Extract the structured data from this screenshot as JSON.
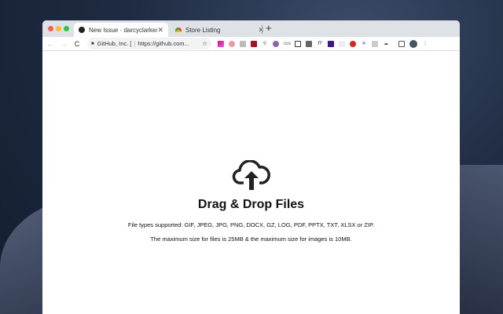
{
  "tabs": [
    {
      "title": "New Issue · darcyclarke/octofi",
      "icon": "github-icon"
    },
    {
      "title": "Store Listing",
      "icon": "chrome-webstore-icon"
    }
  ],
  "omnibox": {
    "site": "GitHub, Inc. [",
    "url": "https://github.com..."
  },
  "extensions": [
    "gem-icon",
    "avatar-ext-icon",
    "k-icon",
    "shield-badge-icon",
    "search-icon",
    "octo-icon",
    "css-icon",
    "picture-icon",
    "grid-icon",
    "function-icon",
    "w-icon",
    "blank-icon",
    "blocker-icon",
    "ds-icon",
    "es-icon",
    "cloud-download-icon",
    "cast-icon",
    "profile-avatar",
    "menu-icon"
  ],
  "ext_labels": {
    "css": "css",
    "func": "f?"
  },
  "dropzone": {
    "title": "Drag & Drop Files",
    "types": "File types supported: GIF, JPEG, JPG, PNG, DOCX, GZ, LOG, PDF, PPTX, TXT, XLSX or ZIP.",
    "limits": "The maximum size for files is 25MB & the maximum size for images is 10MB."
  },
  "colors": {
    "close": "#fe5f57",
    "min": "#febc2e",
    "max": "#28c840"
  }
}
